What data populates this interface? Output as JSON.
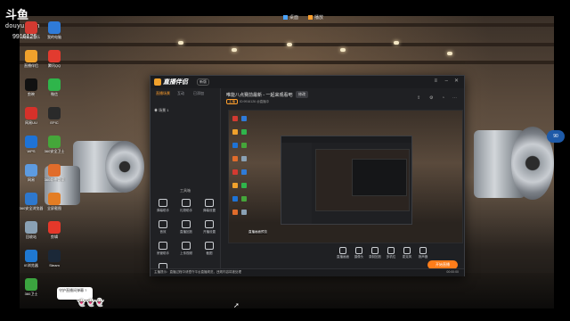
{
  "stream_logo": {
    "title": "斗鱼",
    "subtitle": "douyu.com",
    "room_id": "9916126"
  },
  "top_bar": {
    "items": [
      "桌面",
      "播放"
    ]
  },
  "desktop_icons": [
    {
      "label": "网易云音乐",
      "color": "#d33a31"
    },
    {
      "label": "我的电脑",
      "color": "#2f7bd8"
    },
    {
      "label": "直播伴侣",
      "color": "#f0a12c"
    },
    {
      "label": "腾讯QQ",
      "color": "#e23b2f"
    },
    {
      "label": "剪映",
      "color": "#111111"
    },
    {
      "label": "微信",
      "color": "#2fb54b"
    },
    {
      "label": "网易UU",
      "color": "#d6312a"
    },
    {
      "label": "EPIC",
      "color": "#2a2a2a"
    },
    {
      "label": "WPS",
      "color": "#1e73d6"
    },
    {
      "label": "360安全卫士",
      "color": "#45a63a"
    },
    {
      "label": "网易",
      "color": "#5d9be0"
    },
    {
      "label": "360软件管家",
      "color": "#e06c2b"
    },
    {
      "label": "360安全浏览器",
      "color": "#2e78cd"
    },
    {
      "label": "全屏截图",
      "color": "#e37d24"
    },
    {
      "label": "回收站",
      "color": "#8aa1b4"
    },
    {
      "label": "剪辑",
      "color": "#e5382a"
    },
    {
      "label": "IE浏览器",
      "color": "#1f78d1"
    },
    {
      "label": "Steam",
      "color": "#1b2838"
    },
    {
      "label": "360卫士",
      "color": "#3ba33f"
    }
  ],
  "app": {
    "logo": "直播伴侣",
    "version": "新版",
    "tabs": [
      "直播场景",
      "互动",
      "已添加"
    ],
    "scene_label": "场景 1",
    "tools_title": "工具箱",
    "tools": [
      "弹幕助手",
      "礼物助手",
      "弹幕设置",
      "音效",
      "直播回放",
      "开播设置",
      "房管助手",
      "上传视频",
      "截图",
      "更多"
    ],
    "stream_title": "唯能八点赛前最新 - 一起来观看吧",
    "edit_tag": "修改",
    "meta_tag": "主播",
    "meta_text": "ID:9916126  @直播中",
    "bottom_tools": [
      "直播画面",
      "摄像头",
      "录制回放",
      "多机位",
      "麦克风",
      "扬声器"
    ],
    "go_live": "开始直播",
    "status_text": "主播提示：直播过程中请遵守平台直播规范，违规内容将被处理",
    "status_right": "00:00:00"
  },
  "preview_badge": "直播画面预览",
  "notice": "守护直播间弹幕 ?",
  "side_badge": "90"
}
